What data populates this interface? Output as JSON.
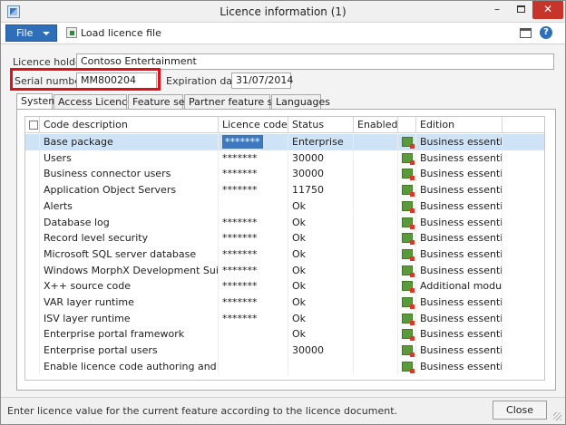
{
  "window": {
    "title": "Licence information (1)",
    "minimize_glyph": "–",
    "close_glyph": "✕"
  },
  "toolbar": {
    "file_label": "File",
    "load_label": "Load licence file",
    "help_glyph": "?"
  },
  "fields": {
    "licence_holder_label": "Licence holder:",
    "licence_holder_value": "Contoso Entertainment",
    "serial_number_label": "Serial number:",
    "serial_number_value": "MM800204",
    "expiration_label": "Expiration date:",
    "expiration_value": "31/07/2014"
  },
  "tabs": [
    {
      "label": "System",
      "active": true
    },
    {
      "label": "Access Licences",
      "active": false
    },
    {
      "label": "Feature sets",
      "active": false
    },
    {
      "label": "Partner feature sets",
      "active": false
    },
    {
      "label": "Languages",
      "active": false
    }
  ],
  "grid": {
    "columns": {
      "code_description": "Code description",
      "licence_code": "Licence code",
      "status": "Status",
      "enabled": "Enabled",
      "edition": "Edition"
    },
    "rows": [
      {
        "description": "Base package",
        "code": "*******",
        "status": "Enterprise",
        "enabled": true,
        "edition": "Business essential"
      },
      {
        "description": "Users",
        "code": "*******",
        "status": "30000",
        "enabled": true,
        "edition": "Business essential"
      },
      {
        "description": "Business connector users",
        "code": "*******",
        "status": "30000",
        "enabled": true,
        "edition": "Business essential"
      },
      {
        "description": "Application Object Servers",
        "code": "*******",
        "status": "11750",
        "enabled": true,
        "edition": "Business essential"
      },
      {
        "description": "Alerts",
        "code": "",
        "status": "Ok",
        "enabled": true,
        "edition": "Business essential"
      },
      {
        "description": "Database log",
        "code": "*******",
        "status": "Ok",
        "enabled": true,
        "edition": "Business essential"
      },
      {
        "description": "Record level security",
        "code": "*******",
        "status": "Ok",
        "enabled": true,
        "edition": "Business essential"
      },
      {
        "description": "Microsoft SQL server database",
        "code": "*******",
        "status": "Ok",
        "enabled": true,
        "edition": "Business essential"
      },
      {
        "description": "Windows MorphX Development Suite",
        "code": "*******",
        "status": "Ok",
        "enabled": true,
        "edition": "Business essential"
      },
      {
        "description": "X++ source code",
        "code": "*******",
        "status": "Ok",
        "enabled": true,
        "edition": "Additional modules"
      },
      {
        "description": "VAR layer runtime",
        "code": "*******",
        "status": "Ok",
        "enabled": true,
        "edition": "Business essential"
      },
      {
        "description": "ISV layer runtime",
        "code": "*******",
        "status": "Ok",
        "enabled": true,
        "edition": "Business essential"
      },
      {
        "description": "Enterprise portal framework",
        "code": "",
        "status": "Ok",
        "enabled": true,
        "edition": "Business essential"
      },
      {
        "description": "Enterprise portal users",
        "code": "",
        "status": "30000",
        "enabled": true,
        "edition": "Business essential"
      },
      {
        "description": "Enable licence code authoring and editing",
        "code": "",
        "status": "",
        "enabled": false,
        "edition": "Business essential"
      }
    ]
  },
  "statusbar": {
    "message": "Enter licence value for the current feature according to the licence document.",
    "close_label": "Close"
  },
  "colors": {
    "accent": "#2f6fba",
    "highlight_border": "#e0101a",
    "selected_row": "#cfe3f7"
  }
}
